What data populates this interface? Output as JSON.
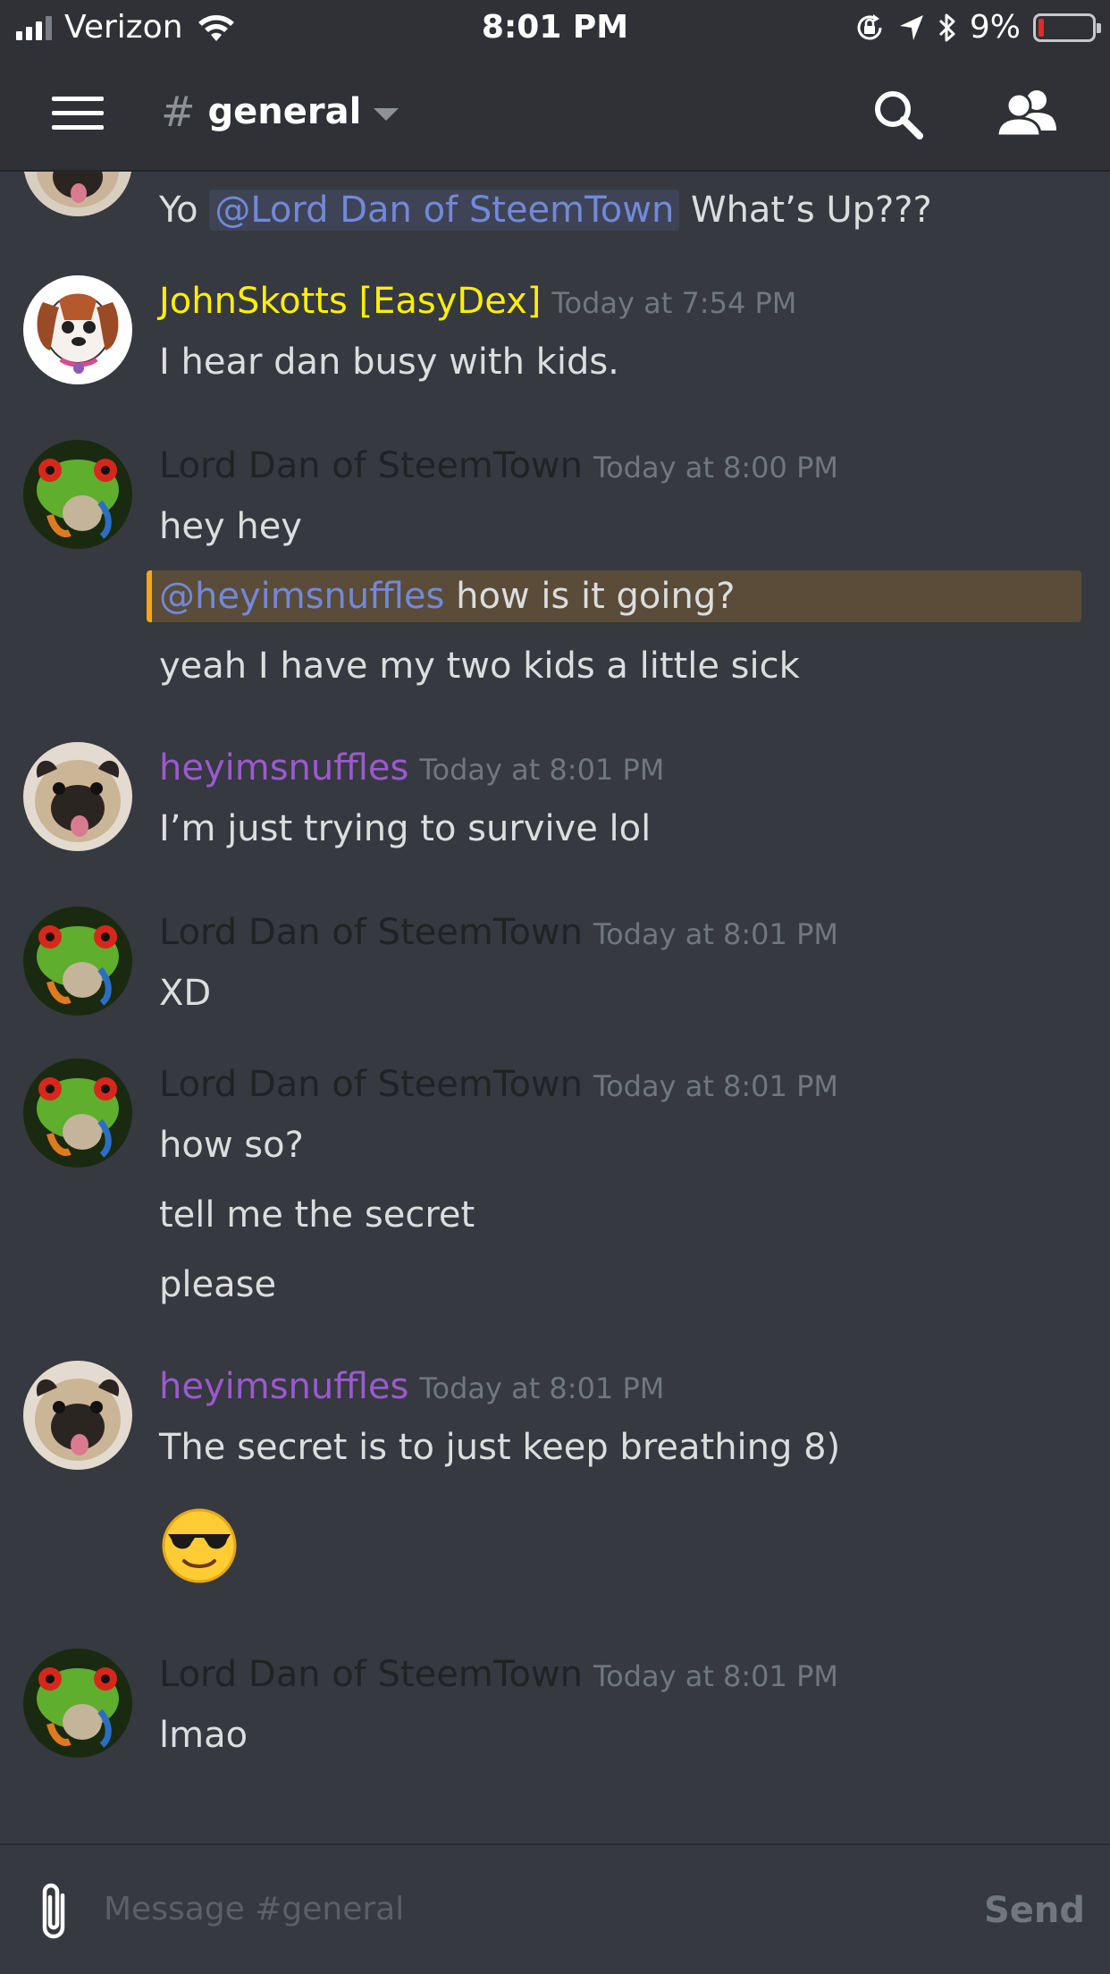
{
  "status_bar": {
    "carrier": "Verizon",
    "time": "8:01 PM",
    "battery": "9%",
    "battery_level": 0.09
  },
  "header": {
    "hash": "#",
    "channel_name": "general"
  },
  "messages": {
    "m0": {
      "text_before": "Yo ",
      "mention": "@Lord Dan of SteemTown",
      "text_after": " What’s Up???"
    },
    "m1": {
      "username": "JohnSkotts [EasyDex]",
      "timestamp": "Today at 7:54 PM",
      "line1": "I hear dan busy with kids."
    },
    "m2": {
      "username": "Lord Dan of SteemTown",
      "timestamp": "Today at 8:00 PM",
      "line1": "hey hey",
      "line2_mention": "@heyimsnuffles",
      "line2_text": " how is it going?",
      "line3": "yeah I have my two kids a little sick"
    },
    "m3": {
      "username": "heyimsnuffles",
      "timestamp": "Today at 8:01 PM",
      "line1": "I’m just trying to survive lol"
    },
    "m4": {
      "username": "Lord Dan of SteemTown",
      "timestamp": "Today at 8:01 PM",
      "line1": "XD"
    },
    "m5": {
      "username": "Lord Dan of SteemTown",
      "timestamp": "Today at 8:01 PM",
      "line1": "how so?",
      "line2": "tell me the secret",
      "line3": "please"
    },
    "m6": {
      "username": "heyimsnuffles",
      "timestamp": "Today at 8:01 PM",
      "line1": "The secret is to just keep breathing 8)",
      "emoji": "sunglasses-emoji"
    },
    "m7": {
      "username": "Lord Dan of SteemTown",
      "timestamp": "Today at 8:01 PM",
      "line1": "lmao"
    }
  },
  "composer": {
    "placeholder": "Message #general",
    "send_label": "Send"
  },
  "colors": {
    "background": "#36393f",
    "header": "#2f3136",
    "mention": "#7289da",
    "highlight_bg": "#5a4c39",
    "highlight_border": "#faa61a",
    "username_john": "#fff000",
    "username_snuffles": "#9b59d0",
    "username_dan": "#202225"
  },
  "icons": [
    "cellular-signal-icon",
    "wifi-icon",
    "orientation-lock-icon",
    "location-arrow-icon",
    "bluetooth-icon",
    "battery-icon",
    "hamburger-menu-icon",
    "search-icon",
    "members-icon",
    "paperclip-icon"
  ]
}
